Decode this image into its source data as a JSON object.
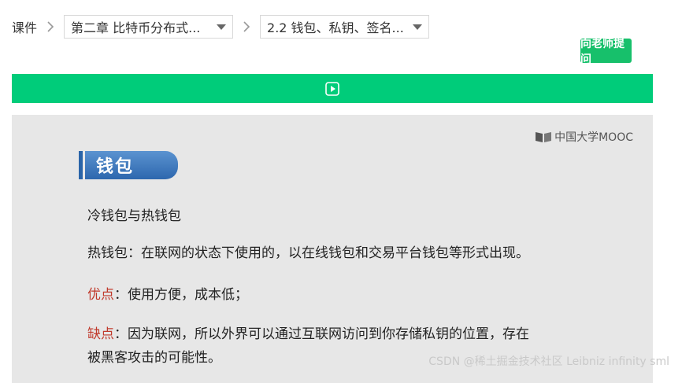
{
  "breadcrumb": {
    "root": "课件",
    "chapter": "第二章 比特币分布式...",
    "section": "2.2 钱包、私钥、签名..."
  },
  "ask_button": "向老师提问",
  "slide": {
    "logo_text": "中国大学MOOC",
    "title": "钱包",
    "subtitle": "冷钱包与热钱包",
    "hot_wallet": "热钱包：在联网的状态下使用的，以在线钱包和交易平台钱包等形式出现。",
    "pros_label": "优点",
    "pros_text": "：使用方便，成本低；",
    "cons_label": "缺点",
    "cons_text_line1": "：因为联网，所以外界可以通过互联网访问到你存储私钥的位置，存在",
    "cons_text_line2": "被黑客攻击的可能性。"
  },
  "watermark": "CSDN @稀土掘金技术社区 Leibniz infinity sml",
  "colors": {
    "green_bar": "#00cc7a",
    "ask_button": "#17c06b",
    "title_pill": "#2d67ae",
    "label_red": "#c0392b",
    "slide_bg": "#e7e7e7"
  }
}
